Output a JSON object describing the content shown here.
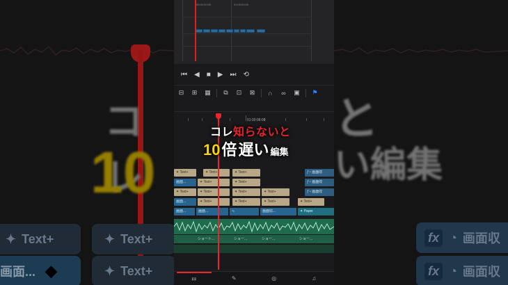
{
  "background": {
    "big_text_left": "コレ",
    "big_text_right": "と",
    "big_number": "10",
    "big_text_edit": "い編集",
    "tiles": {
      "text_plus": "Text+",
      "screen": "画面...",
      "screen_right": "画面収"
    }
  },
  "viewer": {
    "label_left": "00:00:00:00",
    "label_right": "01:00:00:00",
    "mini_clip": "Text+"
  },
  "transport": {
    "first": "⏮",
    "prev": "◀",
    "stop": "■",
    "play": "▶",
    "last": "⏭",
    "loop": "⟲"
  },
  "toolbar": {
    "tools": [
      "▯⃞",
      "⟷",
      "▦",
      "⧉",
      "⬚",
      "⊡",
      "⌁",
      "🔗",
      "🔒",
      "⚑"
    ]
  },
  "ruler": {
    "timecode": "01:00:08:00"
  },
  "title": {
    "line1_white": "コレ",
    "line1_red": "知らないと",
    "line2_yellow": "10",
    "line2_white": "倍",
    "line2_yellow2": "遅い",
    "line2_small": "編集"
  },
  "tracks": {
    "text_clip": "Text+",
    "screen_clip": "画面...",
    "screen_clip2": "画面収...",
    "paper_clip": "Paper",
    "fx_label": "画面収",
    "short_clip": "ショート...",
    "short_clip2": "ショー..."
  },
  "bottom_tabs": [
    "⚏",
    "✎",
    "◎",
    "♫"
  ],
  "colors": {
    "accent_red": "#e8262b",
    "accent_yellow": "#ffd400",
    "clip_tan": "#b9a887",
    "clip_blue": "#27648f",
    "audio_green": "#1f6b4e"
  }
}
